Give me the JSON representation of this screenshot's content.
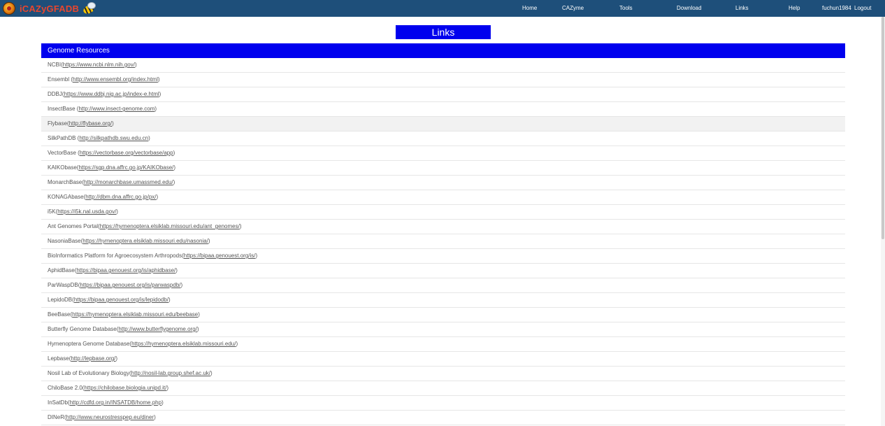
{
  "brand": {
    "name": "iCAZyGFADB"
  },
  "nav": {
    "items": [
      {
        "label": "Home"
      },
      {
        "label": "CAZyme"
      },
      {
        "label": "Tools"
      },
      {
        "label": "Download"
      },
      {
        "label": "Links"
      },
      {
        "label": "Help"
      },
      {
        "label": "fuchun1984"
      },
      {
        "label": "Logout"
      }
    ]
  },
  "page": {
    "title": "Links"
  },
  "section": {
    "title": "Genome Resources",
    "links": [
      {
        "name": "NCBI(",
        "url": "https://www.ncbi.nlm.nih.gov/",
        "suffix": ")"
      },
      {
        "name": "Ensembl (",
        "url": "http://www.ensembl.org/index.html",
        "suffix": ")"
      },
      {
        "name": "DDBJ(",
        "url": "https://www.ddbj.nig.ac.jp/index-e.html",
        "suffix": ")"
      },
      {
        "name": "InsectBase (",
        "url": "http://www.insect-genome.com",
        "suffix": ")"
      },
      {
        "name": "Flybase(",
        "url": "http://flybase.org/",
        "suffix": ")"
      },
      {
        "name": "SilkPathDB (",
        "url": "http://silkpathdb.swu.edu.cn",
        "suffix": ")"
      },
      {
        "name": "VectorBase (",
        "url": "https://vectorbase.org/vectorbase/app",
        "suffix": ")"
      },
      {
        "name": "KAIKObase(",
        "url": "https://sgp.dna.affrc.go.jp/KAIKObase/",
        "suffix": ")"
      },
      {
        "name": "MonarchBase(",
        "url": "http://monarchbase.umassmed.edu/",
        "suffix": ")"
      },
      {
        "name": "KONAGAbase(",
        "url": "http://dbm.dna.affrc.go.jp/px/",
        "suffix": ")"
      },
      {
        "name": "i5K(",
        "url": "https://i5k.nal.usda.gov/",
        "suffix": ")"
      },
      {
        "name": "Ant Genomes Portal(",
        "url": "https://hymenoptera.elsiklab.missouri.edu/ant_genomes/",
        "suffix": ")"
      },
      {
        "name": "NasoniaBase(",
        "url": "https://hymenoptera.elsiklab.missouri.edu/nasonia/",
        "suffix": ")"
      },
      {
        "name": "BioInformatics Platform for Agroecosystem Arthropods(",
        "url": "https://bipaa.genouest.org/is/",
        "suffix": ")"
      },
      {
        "name": "AphidBase(",
        "url": "https://bipaa.genouest.org/is/aphidbase/",
        "suffix": ")"
      },
      {
        "name": "ParWaspDB(",
        "url": "https://bipaa.genouest.org/is/parwaspdb/",
        "suffix": ")"
      },
      {
        "name": "LepidoDB(",
        "url": "https://bipaa.genouest.org/is/lepidodb/",
        "suffix": ")"
      },
      {
        "name": "BeeBase(",
        "url": "https://hymenoptera.elsiklab.missouri.edu/beebase",
        "suffix": ")"
      },
      {
        "name": "Butterfly Genome Database(",
        "url": "http://www.butterflygenome.org/",
        "suffix": ")"
      },
      {
        "name": "Hymenoptera Genome Database(",
        "url": "https://hymenoptera.elsiklab.missouri.edu/",
        "suffix": ")"
      },
      {
        "name": "Lepbase(",
        "url": "http://lepbase.org/",
        "suffix": ")"
      },
      {
        "name": "Nosil Lab of Evolutionary Biology(",
        "url": "http://nosil-lab.group.shef.ac.uk/",
        "suffix": ")"
      },
      {
        "name": "ChiloBase 2.0(",
        "url": "https://chilobase.biologia.unipd.it/",
        "suffix": ")"
      },
      {
        "name": "InSatDb(",
        "url": "http://cdfd.org.in/INSATDB/home.php",
        "suffix": ")"
      },
      {
        "name": "DINeR(",
        "url": "http://www.neurostresspep.eu/diner",
        "suffix": ")"
      }
    ]
  },
  "colors": {
    "navbar": "#1e4f7a",
    "accent": "#0000ee",
    "highlight_row": "#f2f2f2"
  },
  "icons": {
    "logo": "ladybug-logo-icon",
    "bee": "bee-icon"
  }
}
